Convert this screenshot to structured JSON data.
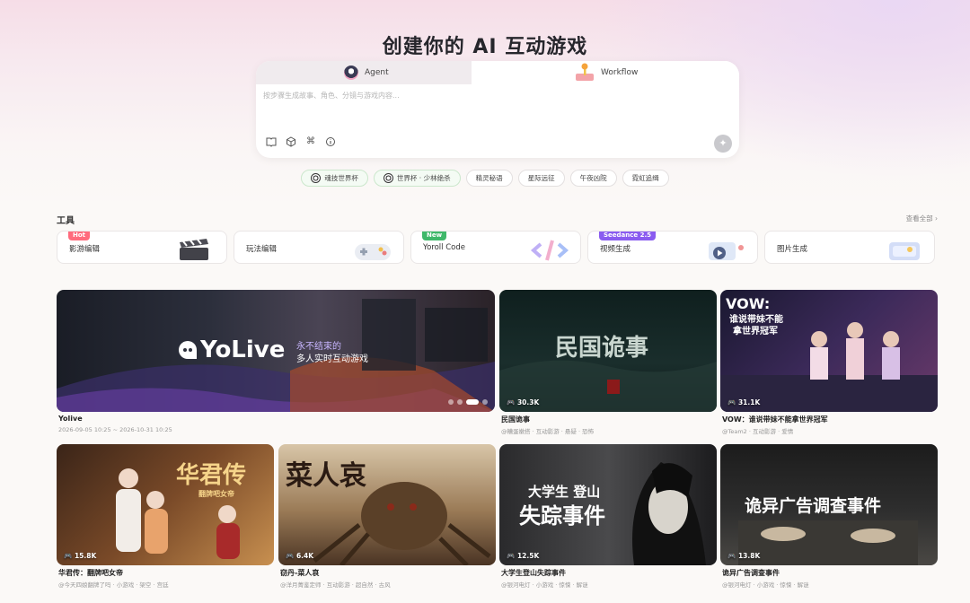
{
  "header": {
    "title": "创建你的 AI 互动游戏"
  },
  "prompt": {
    "tabs": [
      {
        "label": "Agent"
      },
      {
        "label": "Workflow"
      }
    ],
    "placeholder": "按步骤生成故事、角色、分镜与游戏内容...",
    "icons": [
      "book-icon",
      "cube-icon",
      "command-icon",
      "info-icon"
    ],
    "send_icon": "sparkle-icon"
  },
  "suggestions": [
    {
      "label": "魂技世界杯",
      "icon": "soccer-ball-icon"
    },
    {
      "label": "世界杯 · 少林绝杀",
      "icon": "soccer-ball-icon"
    },
    {
      "label": "精灵秘语"
    },
    {
      "label": "星际远征"
    },
    {
      "label": "午夜凶院"
    },
    {
      "label": "霓虹追缉"
    }
  ],
  "tools_section": {
    "title": "工具",
    "see_all": "查看全部",
    "items": [
      {
        "label": "影游编辑",
        "badge": "Hot",
        "badge_color": "#ff6b7d"
      },
      {
        "label": "玩法编辑",
        "badge": ""
      },
      {
        "label": "Yoroll Code",
        "badge": "New",
        "badge_color": "#3fb86a"
      },
      {
        "label": "视频生成",
        "badge": "Seedance 2.5",
        "badge_color": "#8a5cf0"
      },
      {
        "label": "图片生成",
        "badge": ""
      }
    ]
  },
  "feature": {
    "brand": "YoLive",
    "tagline_1": "永不结束的",
    "tagline_2": "多人实时互动游戏",
    "title": "Yolive",
    "date": "2026-09-05 10:25 ~ 2026-10-31 10:25"
  },
  "cards": [
    {
      "title": "民国诡事",
      "sub": "@糟蛋嫩搭 · 互动影游 · 悬疑 · 恐怖",
      "plays": "30.3K",
      "cover_text": "民国诡事"
    },
    {
      "title": "VOW：谁说带妹不能拿世界冠军",
      "sub": "@Team2 · 互动影游 · 爱情",
      "plays": "31.1K",
      "cover_text_1": "VOW:",
      "cover_text_2": "谁说带妹不能",
      "cover_text_3": "拿世界冠军"
    },
    {
      "title": "华君传：翻牌吧女帝",
      "sub": "@今天四娘翻牌了吗 · 小游戏 · 架空 · 宫廷",
      "plays": "15.8K",
      "cover_text": "华君传",
      "cover_small": "翻牌吧女帝"
    },
    {
      "title": "窃丹-菜人哀",
      "sub": "@洋月菁鉴定师 · 互动影游 · 超自然 · 古风",
      "plays": "6.4K",
      "cover_text": "菜人哀"
    },
    {
      "title": "大学生登山失踪事件",
      "sub": "@银河电灯 · 小游戏 · 惊悚 · 解谜",
      "plays": "12.5K",
      "cover_text_1": "大学生 登山",
      "cover_text_2": "失踪事件"
    },
    {
      "title": "诡异广告调查事件",
      "sub": "@银河电灯 · 小游戏 · 惊悚 · 解谜",
      "plays": "13.8K",
      "cover_text": "诡异广告调查事件"
    }
  ],
  "colors": {
    "accent": "#8a5cf0",
    "hot": "#ff6b7d",
    "new": "#3fb86a"
  }
}
